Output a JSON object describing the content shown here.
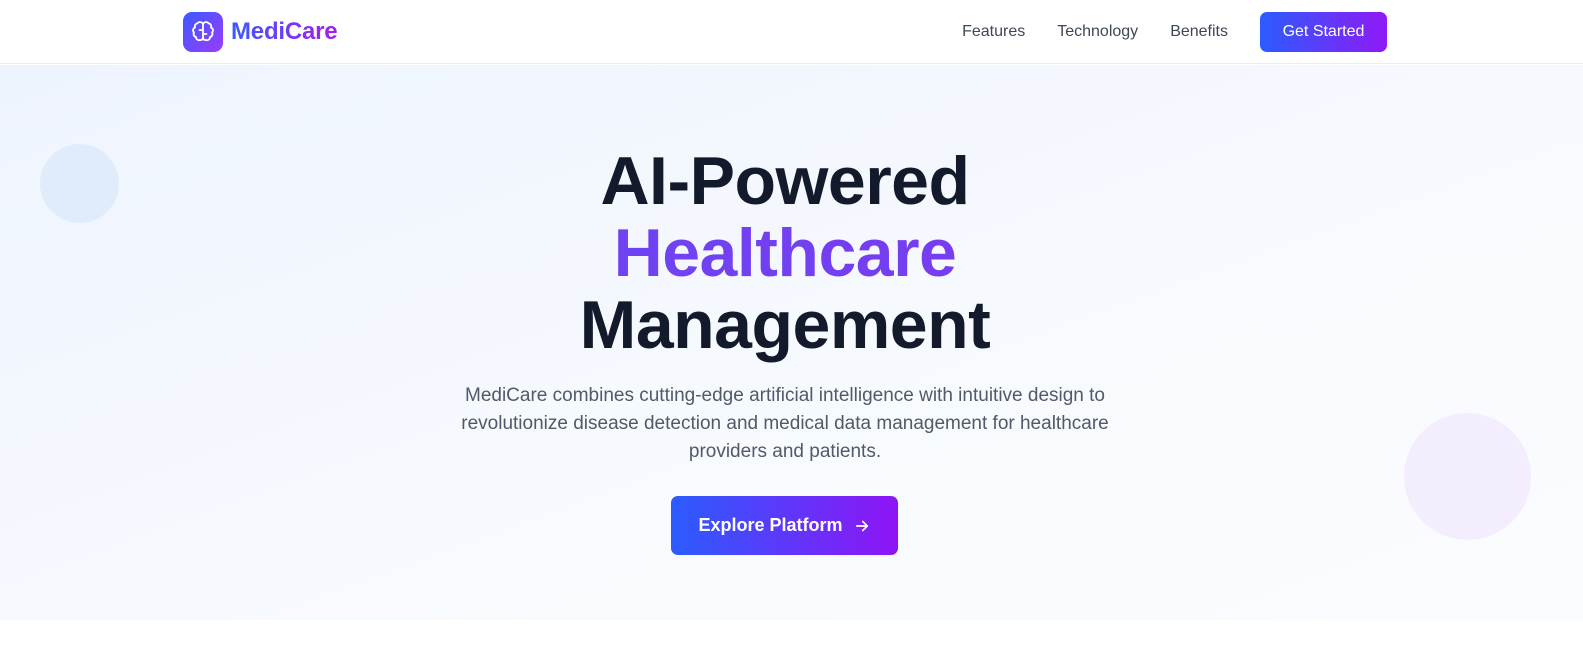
{
  "brand": {
    "name": "MediCare",
    "icon": "brain-icon"
  },
  "nav": {
    "links": [
      "Features",
      "Technology",
      "Benefits"
    ],
    "cta_label": "Get Started"
  },
  "hero": {
    "headline_line1": "AI-Powered",
    "headline_accent": "Healthcare",
    "headline_line3": "Management",
    "description": "MediCare combines cutting-edge artificial intelligence with intuitive design to revolutionize disease detection and medical data management for healthcare providers and patients.",
    "button_label": "Explore Platform",
    "button_icon": "arrow-right-icon"
  },
  "colors": {
    "gradient_start": "#2b5cff",
    "gradient_end": "#8f1af5",
    "heading": "#121a2b",
    "accent": "#6a3af2",
    "body_text": "#515a69"
  }
}
